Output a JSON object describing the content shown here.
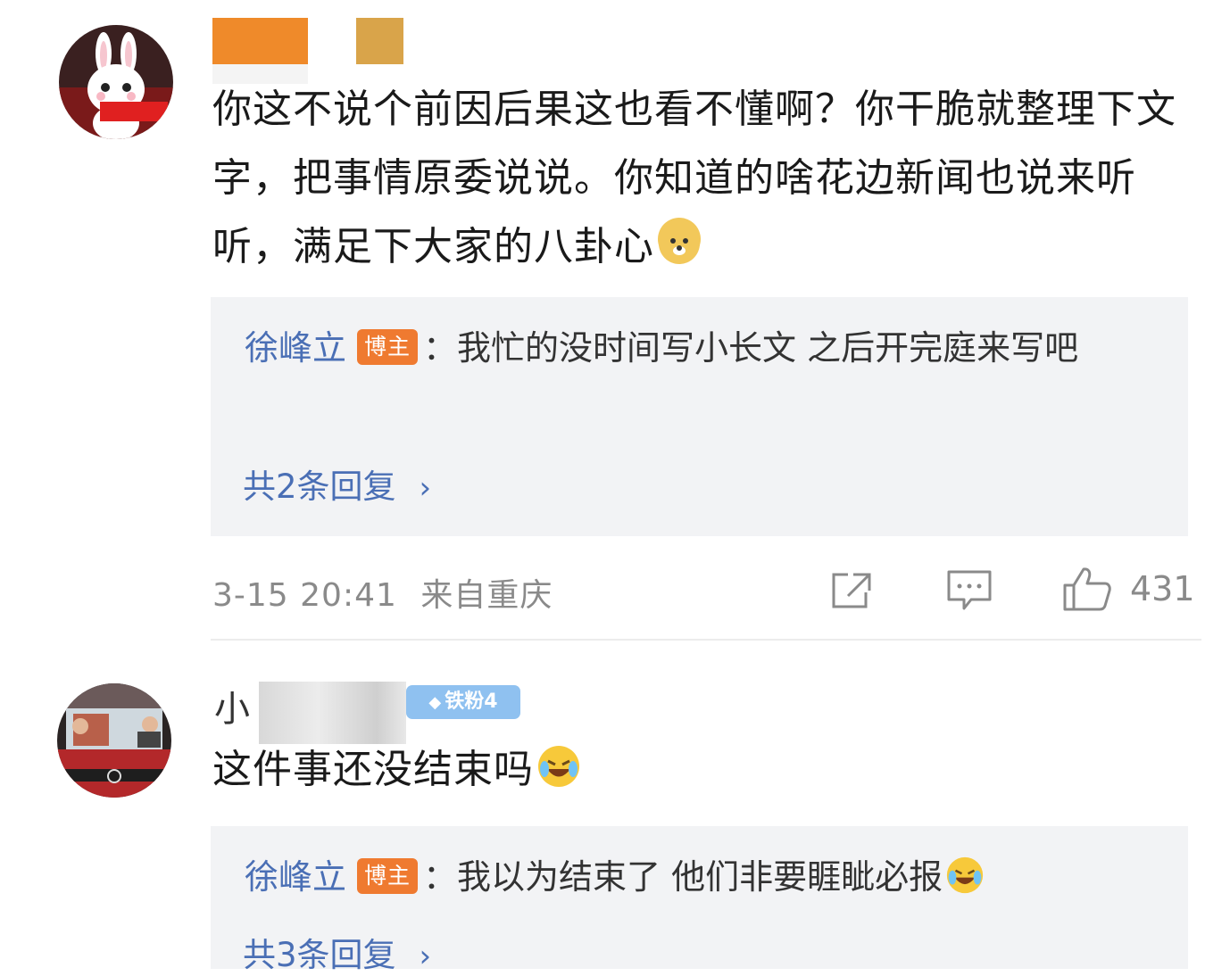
{
  "comments": [
    {
      "text": "你这不说个前因后果这也看不懂啊？你干脆就整理下文字，把事情原委说说。你知道的啥花边新闻也说来听听，满足下大家的八卦心",
      "emoji": "doge-emoji",
      "reply": {
        "author": "徐峰立",
        "badge": "博主",
        "separator": "：",
        "text": "我忙的没时间写小长文 之后开完庭来写吧",
        "more": "共2条回复",
        "chevron": "›"
      },
      "time": "3-15 20:41",
      "location": "来自重庆",
      "likes": "431"
    },
    {
      "name_visible": "小",
      "fan_badge": "铁粉4",
      "text": "这件事还没结束吗",
      "emoji": "laugh-cry-emoji",
      "reply": {
        "author": "徐峰立",
        "badge": "博主",
        "separator": "：",
        "text": "我以为结束了 他们非要睚眦必报",
        "emoji": "laugh-cry-emoji",
        "more": "共3条回复",
        "chevron": "›"
      }
    }
  ],
  "colors": {
    "link": "#4a6fb5",
    "badge": "#ef7a30",
    "reply_bg": "#f2f3f5",
    "meta": "#8a8a8a",
    "name_redaction_1": "#ef8a2a",
    "name_redaction_2": "#d9a44a"
  }
}
